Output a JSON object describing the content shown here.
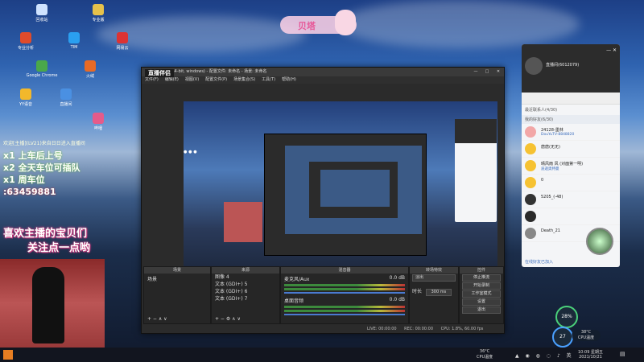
{
  "desktop": {
    "icons": [
      {
        "label": "回收站",
        "color": "#cfe3ff"
      },
      {
        "label": "专业版",
        "color": "#e6c24b"
      },
      {
        "label": "专业分析",
        "color": "#e04b2b"
      },
      {
        "label": "TIM",
        "color": "#2a9ff0"
      },
      {
        "label": "网易云",
        "color": "#d33"
      },
      {
        "label": "Google Chrome",
        "color": "#4aa84a"
      },
      {
        "label": "火绒",
        "color": "#e86a25"
      },
      {
        "label": "YY语音",
        "color": "#f2b82b"
      },
      {
        "label": "直播间",
        "color": "#4a90e2"
      },
      {
        "label": "哔哩",
        "color": "#e55b8a"
      }
    ]
  },
  "overlay": {
    "welcome": "欢迎[主播](LV21)来自日日进入直播间",
    "lines": [
      "x1 上车后上号",
      "x2 全天车位可插队",
      "x1 周车位",
      ":63459881"
    ],
    "big_text_1": "喜欢主播的宝贝们",
    "big_text_2": "关注点一点哟",
    "badge": "贝塔"
  },
  "obs": {
    "title": "OBS 26.0.2 (64-bit, windows) - 配置文件: 未命名 - 场景: 未命名",
    "brand": "直播伴侣",
    "menu": [
      "文件(F)",
      "编辑(E)",
      "视图(V)",
      "配置文件(P)",
      "场景集合(S)",
      "工具(T)",
      "帮助(H)"
    ],
    "docks": {
      "scenes": {
        "title": "场景",
        "items": [
          "场景"
        ]
      },
      "sources": {
        "title": "来源",
        "items": [
          "图像 4",
          "文本 (GDI+) 5",
          "文本 (GDI+) 6",
          "文本 (GDI+) 7"
        ]
      },
      "mixer": {
        "title": "混音器",
        "tracks": [
          {
            "name": "麦克风/Aux",
            "db": "0.0 dB"
          },
          {
            "name": "桌面音频",
            "db": "0.0 dB"
          }
        ]
      },
      "transitions": {
        "title": "转场特效",
        "type": "淡出",
        "duration_label": "时长",
        "duration": "300 ms"
      },
      "controls": {
        "title": "控件",
        "buttons": [
          "停止推流",
          "开始录制",
          "工作室模式",
          "设置",
          "退出"
        ]
      }
    },
    "status": {
      "live": "LIVE: 00:00:00",
      "rec": "REC: 00:00:00",
      "cpu": "CPU: 1.8%, 60.00 fps"
    }
  },
  "chat_window": {
    "user": "直播间(6012079)",
    "section_1": "最近联系人(4/30)",
    "section_2": "我的好友(6/30)",
    "friends": [
      {
        "name": "24128-墨林",
        "sub": "DouYuTV-8848820",
        "color": "#f2a7a7"
      },
      {
        "name": "唐唐(无无)",
        "sub": "",
        "color": "#f6c232"
      },
      {
        "name": "晴风雨 风 (对面第一明)",
        "sub": "迪迦奥特曼",
        "color": "#f6c232"
      },
      {
        "name": "0",
        "sub": "",
        "color": "#f6c232"
      },
      {
        "name": "5205_(-48)",
        "sub": "",
        "color": "#333"
      },
      {
        "name": "",
        "sub": "",
        "color": "#2a2a2a"
      },
      {
        "name": "Death_21",
        "sub": "",
        "color": "#888"
      }
    ],
    "footer": "在线好友已加入"
  },
  "gauges": {
    "mem": "28%",
    "cpu": "27",
    "temp": "38°C",
    "temp_label": "CPU温度"
  },
  "taskbar": {
    "weather": "36°C",
    "weather_label": "CPU温度",
    "time": "10:09 星期五",
    "date": "2021/10/21"
  }
}
